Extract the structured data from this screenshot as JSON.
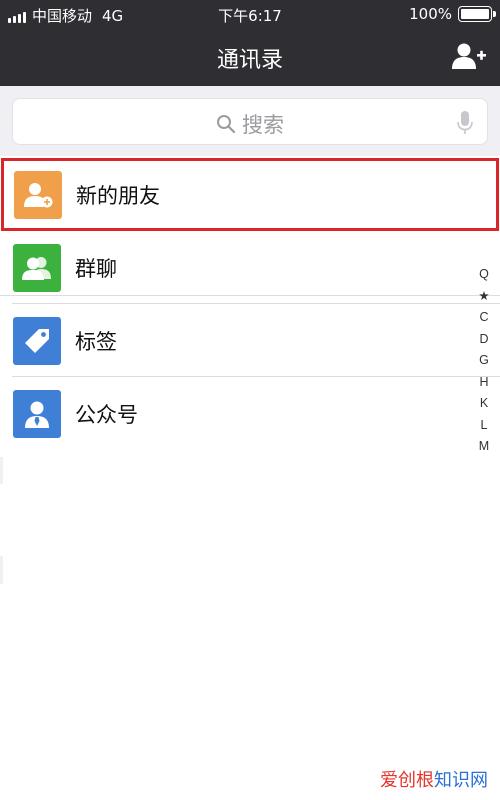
{
  "status_bar": {
    "carrier": "中国移动",
    "network": "4G",
    "time": "下午6:17",
    "battery": "100%",
    "battery_level": 1.0
  },
  "header": {
    "title": "通讯录",
    "add_contact_icon": "add-contact-icon"
  },
  "search": {
    "placeholder": "搜索",
    "search_icon": "search-icon",
    "voice_icon": "microphone-icon"
  },
  "list": {
    "items": [
      {
        "label": "新的朋友",
        "icon": "new-friend-icon",
        "color": "#f0a04b",
        "highlighted": true
      },
      {
        "label": "群聊",
        "icon": "group-chat-icon",
        "color": "#3db13d"
      },
      {
        "label": "标签",
        "icon": "tag-icon",
        "color": "#3f7fd6"
      },
      {
        "label": "公众号",
        "icon": "official-account-icon",
        "color": "#3f7fd6"
      }
    ]
  },
  "index_bar": {
    "items": [
      "Q",
      "★",
      "C",
      "D",
      "G",
      "H",
      "K",
      "L",
      "M"
    ]
  },
  "watermark": {
    "brand": "爱创根",
    "rest": "知识网"
  },
  "colors": {
    "nav_background": "#2e2e33",
    "highlight_border": "#d9262b",
    "page_background": "#efeff4"
  }
}
